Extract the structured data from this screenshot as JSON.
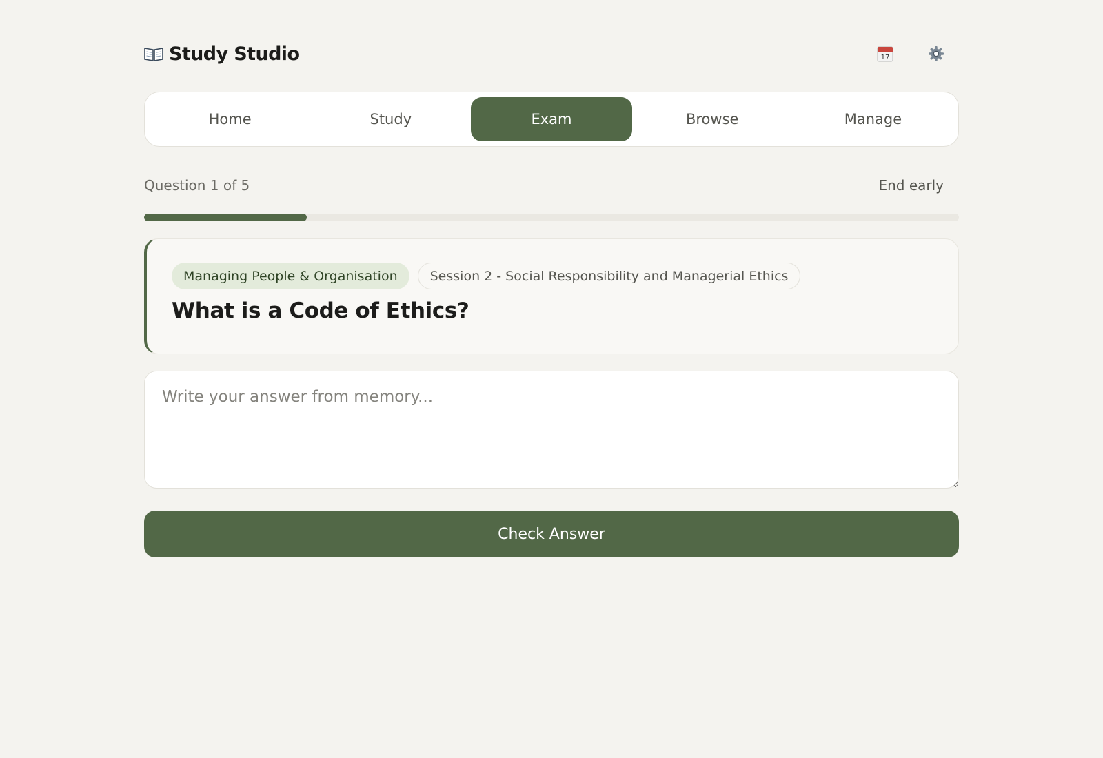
{
  "app": {
    "title": "Study Studio",
    "brand_icon": "open-book-icon"
  },
  "header": {
    "calendar_icon": "calendar-icon",
    "calendar_day": "17",
    "settings_icon": "gear-icon"
  },
  "nav": {
    "tabs": [
      {
        "label": "Home",
        "active": false
      },
      {
        "label": "Study",
        "active": false
      },
      {
        "label": "Exam",
        "active": true
      },
      {
        "label": "Browse",
        "active": false
      },
      {
        "label": "Manage",
        "active": false
      }
    ]
  },
  "exam": {
    "counter": "Question 1 of 5",
    "end_early": "End early",
    "progress_fraction": 0.2
  },
  "question": {
    "module_tag": "Managing People & Organisation",
    "session_tag": "Session 2 - Social Responsibility and Managerial Ethics",
    "text": "What is a Code of Ethics?"
  },
  "answer": {
    "value": "",
    "placeholder": "Write your answer from memory..."
  },
  "actions": {
    "check_label": "Check Answer"
  },
  "colors": {
    "accent": "#526847",
    "background": "#f4f3ef",
    "tag_bg": "#e3ebdb"
  }
}
